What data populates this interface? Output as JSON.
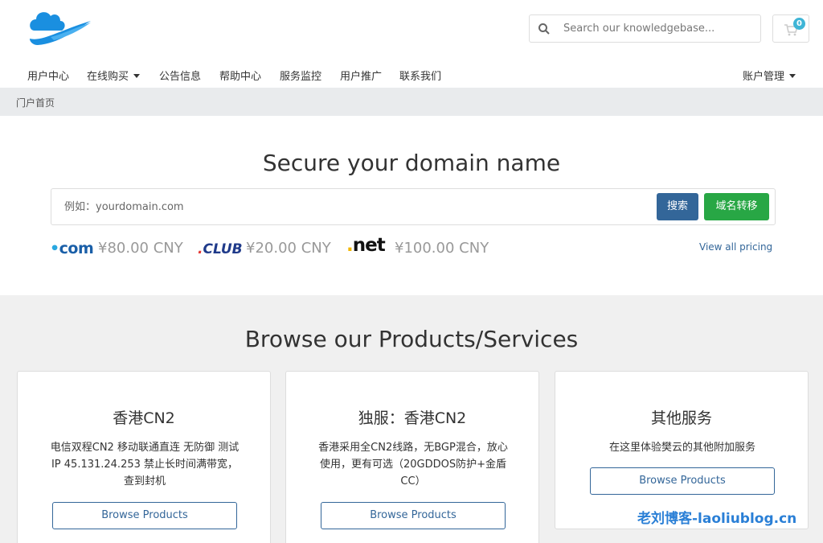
{
  "header": {
    "search_placeholder": "Search our knowledgebase...",
    "cart_count": "0"
  },
  "nav": {
    "items": [
      {
        "label": "用户中心"
      },
      {
        "label": "在线购买"
      },
      {
        "label": "公告信息"
      },
      {
        "label": "帮助中心"
      },
      {
        "label": "服务监控"
      },
      {
        "label": "用户推广"
      },
      {
        "label": "联系我们"
      }
    ],
    "account_label": "账户管理"
  },
  "breadcrumb": {
    "home": "门户首页"
  },
  "domain": {
    "title": "Secure your domain name",
    "input_placeholder": "例如：yourdomain.com",
    "search_label": "搜索",
    "transfer_label": "域名转移",
    "tlds": [
      {
        "logo": "com",
        "price": "¥80.00 CNY"
      },
      {
        "logo": "CLUB",
        "price": "¥20.00 CNY"
      },
      {
        "logo": "net",
        "price": "¥100.00 CNY"
      }
    ],
    "view_all": "View all pricing"
  },
  "products": {
    "title": "Browse our Products/Services",
    "cards": [
      {
        "title": "香港CN2",
        "desc": "电信双程CN2 移动联通直连 无防御 测试IP 45.131.24.253 禁止长时间满带宽，查到封机",
        "button": "Browse Products"
      },
      {
        "title": "独服：香港CN2",
        "desc": "香港采用全CN2线路，无BGP混合，放心使用，更有可选（20GDDOS防护+金盾CC）",
        "button": "Browse Products"
      },
      {
        "title": "其他服务",
        "desc": "在这里体验樊云的其他附加服务",
        "button": "Browse Products"
      }
    ]
  },
  "watermark": "老刘博客-laoliublog.cn",
  "colors": {
    "accent": "#336699",
    "success": "#28a745",
    "badge": "#3fb5d6",
    "logo": "#1a8fe0"
  }
}
